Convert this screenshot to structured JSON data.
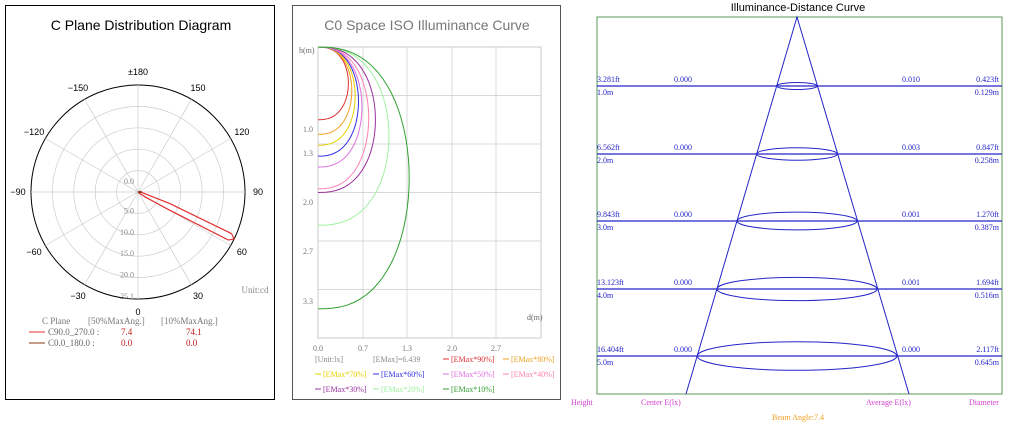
{
  "polar": {
    "title": "C Plane Distribution Diagram",
    "angle_labels": [
      "±180",
      "−150",
      "150",
      "−120",
      "120",
      "−90",
      "90",
      "−60",
      "60",
      "−30",
      "30",
      "0"
    ],
    "radial_labels": [
      "0.0",
      "5.0",
      "10.0",
      "15.0",
      "20.0",
      "25.1"
    ],
    "unit": "Unit:cd",
    "table": {
      "header": [
        "C Plane",
        "[50%MaxAng.]",
        "[10%MaxAng.]"
      ],
      "rows": [
        {
          "name": "C90.0_270.0 :",
          "v50": "7.4",
          "v10": "74.1",
          "color": "#e03030"
        },
        {
          "name": "C0.0_180.0 :",
          "v50": "0.0",
          "v10": "0.0",
          "color": "#8b3a1a"
        }
      ]
    }
  },
  "iso": {
    "title": "C0 Space ISO Illuminance Curve",
    "y_axis_label": "h(m)",
    "x_axis_label": "d(m)",
    "y_ticks": [
      "1.0",
      "1.3",
      "2.0",
      "2.7",
      "3.3"
    ],
    "x_ticks": [
      "0.0",
      "0.7",
      "1.3",
      "2.0",
      "2.7"
    ],
    "unit": "[Unit:lx]",
    "emax": "[EMax]=6.439",
    "legend": [
      {
        "label": "[EMax*90%]",
        "color": "#e03030"
      },
      {
        "label": "[EMax*80%]",
        "color": "#f0a020"
      },
      {
        "label": "[EMax*70%]",
        "color": "#e8d000"
      },
      {
        "label": "[EMax*60%]",
        "color": "#3030e0"
      },
      {
        "label": "[EMax*50%]",
        "color": "#e070e0"
      },
      {
        "label": "[EMax*40%]",
        "color": "#ff80b0"
      },
      {
        "label": "[EMax*30%]",
        "color": "#9a30a0"
      },
      {
        "label": "[EMax*20%]",
        "color": "#a0f0a0"
      },
      {
        "label": "[EMax*10%]",
        "color": "#30a030"
      }
    ]
  },
  "distance": {
    "title": "Illuminance-Distance Curve",
    "rows": [
      {
        "height_ft": "3.281ft",
        "height_m": "1.0m",
        "center": "0.000",
        "average": "0.010",
        "diam_ft": "0.423ft",
        "diam_m": "0.129m"
      },
      {
        "height_ft": "6.562ft",
        "height_m": "2.0m",
        "center": "0.000",
        "average": "0.003",
        "diam_ft": "0.847ft",
        "diam_m": "0.258m"
      },
      {
        "height_ft": "9.843ft",
        "height_m": "3.0m",
        "center": "0.000",
        "average": "0.001",
        "diam_ft": "1.270ft",
        "diam_m": "0.387m"
      },
      {
        "height_ft": "13.123ft",
        "height_m": "4.0m",
        "center": "0.000",
        "average": "0.001",
        "diam_ft": "1.694ft",
        "diam_m": "0.516m"
      },
      {
        "height_ft": "16.404ft",
        "height_m": "5.0m",
        "center": "0.000",
        "average": "0.000",
        "diam_ft": "2.117ft",
        "diam_m": "0.645m"
      }
    ],
    "footer": {
      "height": "Height",
      "center": "Center E(lx)",
      "average": "Average E(lx)",
      "diameter": "Diameter",
      "beam_angle": "Beam Angle:7.4"
    }
  },
  "chart_data": [
    {
      "type": "polar",
      "title": "C Plane Distribution Diagram",
      "unit": "Unit:cd",
      "radial_max": 25.1,
      "series": [
        {
          "name": "C90.0_270.0",
          "color": "#e03030",
          "angle_deg": [
            50,
            55,
            60,
            62,
            64,
            66,
            70,
            75,
            80,
            90
          ],
          "values": [
            0.6,
            2,
            8,
            24,
            25.1,
            24,
            8,
            2,
            1,
            0.8
          ]
        },
        {
          "name": "C0.0_180.0",
          "color": "#8b3a1a",
          "angle_deg": [
            80,
            90,
            100
          ],
          "values": [
            0.6,
            0.8,
            0.6
          ]
        }
      ]
    },
    {
      "type": "line",
      "title": "C0 Space ISO Illuminance Curve",
      "xlabel": "d(m)",
      "ylabel": "h(m)",
      "xlim": [
        0,
        3.3
      ],
      "ylim": [
        0,
        4.0
      ],
      "series": [
        {
          "name": "[EMax*90%]",
          "color": "#e03030",
          "peak": [
            0.45,
            1.0
          ]
        },
        {
          "name": "[EMax*80%]",
          "color": "#f0a020",
          "peak": [
            0.5,
            1.2
          ]
        },
        {
          "name": "[EMax*70%]",
          "color": "#e8d000",
          "peak": [
            0.55,
            1.35
          ]
        },
        {
          "name": "[EMax*60%]",
          "color": "#3030e0",
          "peak": [
            0.6,
            1.5
          ]
        },
        {
          "name": "[EMax*50%]",
          "color": "#e070e0",
          "peak": [
            0.65,
            1.65
          ]
        },
        {
          "name": "[EMax*40%]",
          "color": "#ff80b0",
          "peak": [
            0.75,
            1.95
          ]
        },
        {
          "name": "[EMax*30%]",
          "color": "#9a30a0",
          "peak": [
            0.85,
            2.0
          ]
        },
        {
          "name": "[EMax*20%]",
          "color": "#a0f0a0",
          "peak": [
            1.05,
            2.45
          ]
        },
        {
          "name": "[EMax*10%]",
          "color": "#30a030",
          "peak": [
            1.35,
            3.6
          ]
        }
      ]
    },
    {
      "type": "table",
      "title": "Illuminance-Distance Curve",
      "columns": [
        "Height",
        "Center E(lx)",
        "Average E(lx)",
        "Diameter"
      ],
      "rows": [
        [
          "1.0m",
          "0.000",
          "0.010",
          "0.129m"
        ],
        [
          "2.0m",
          "0.000",
          "0.003",
          "0.258m"
        ],
        [
          "3.0m",
          "0.000",
          "0.001",
          "0.387m"
        ],
        [
          "4.0m",
          "0.000",
          "0.001",
          "0.516m"
        ],
        [
          "5.0m",
          "0.000",
          "0.000",
          "0.645m"
        ]
      ],
      "beam_angle": 7.4
    }
  ]
}
